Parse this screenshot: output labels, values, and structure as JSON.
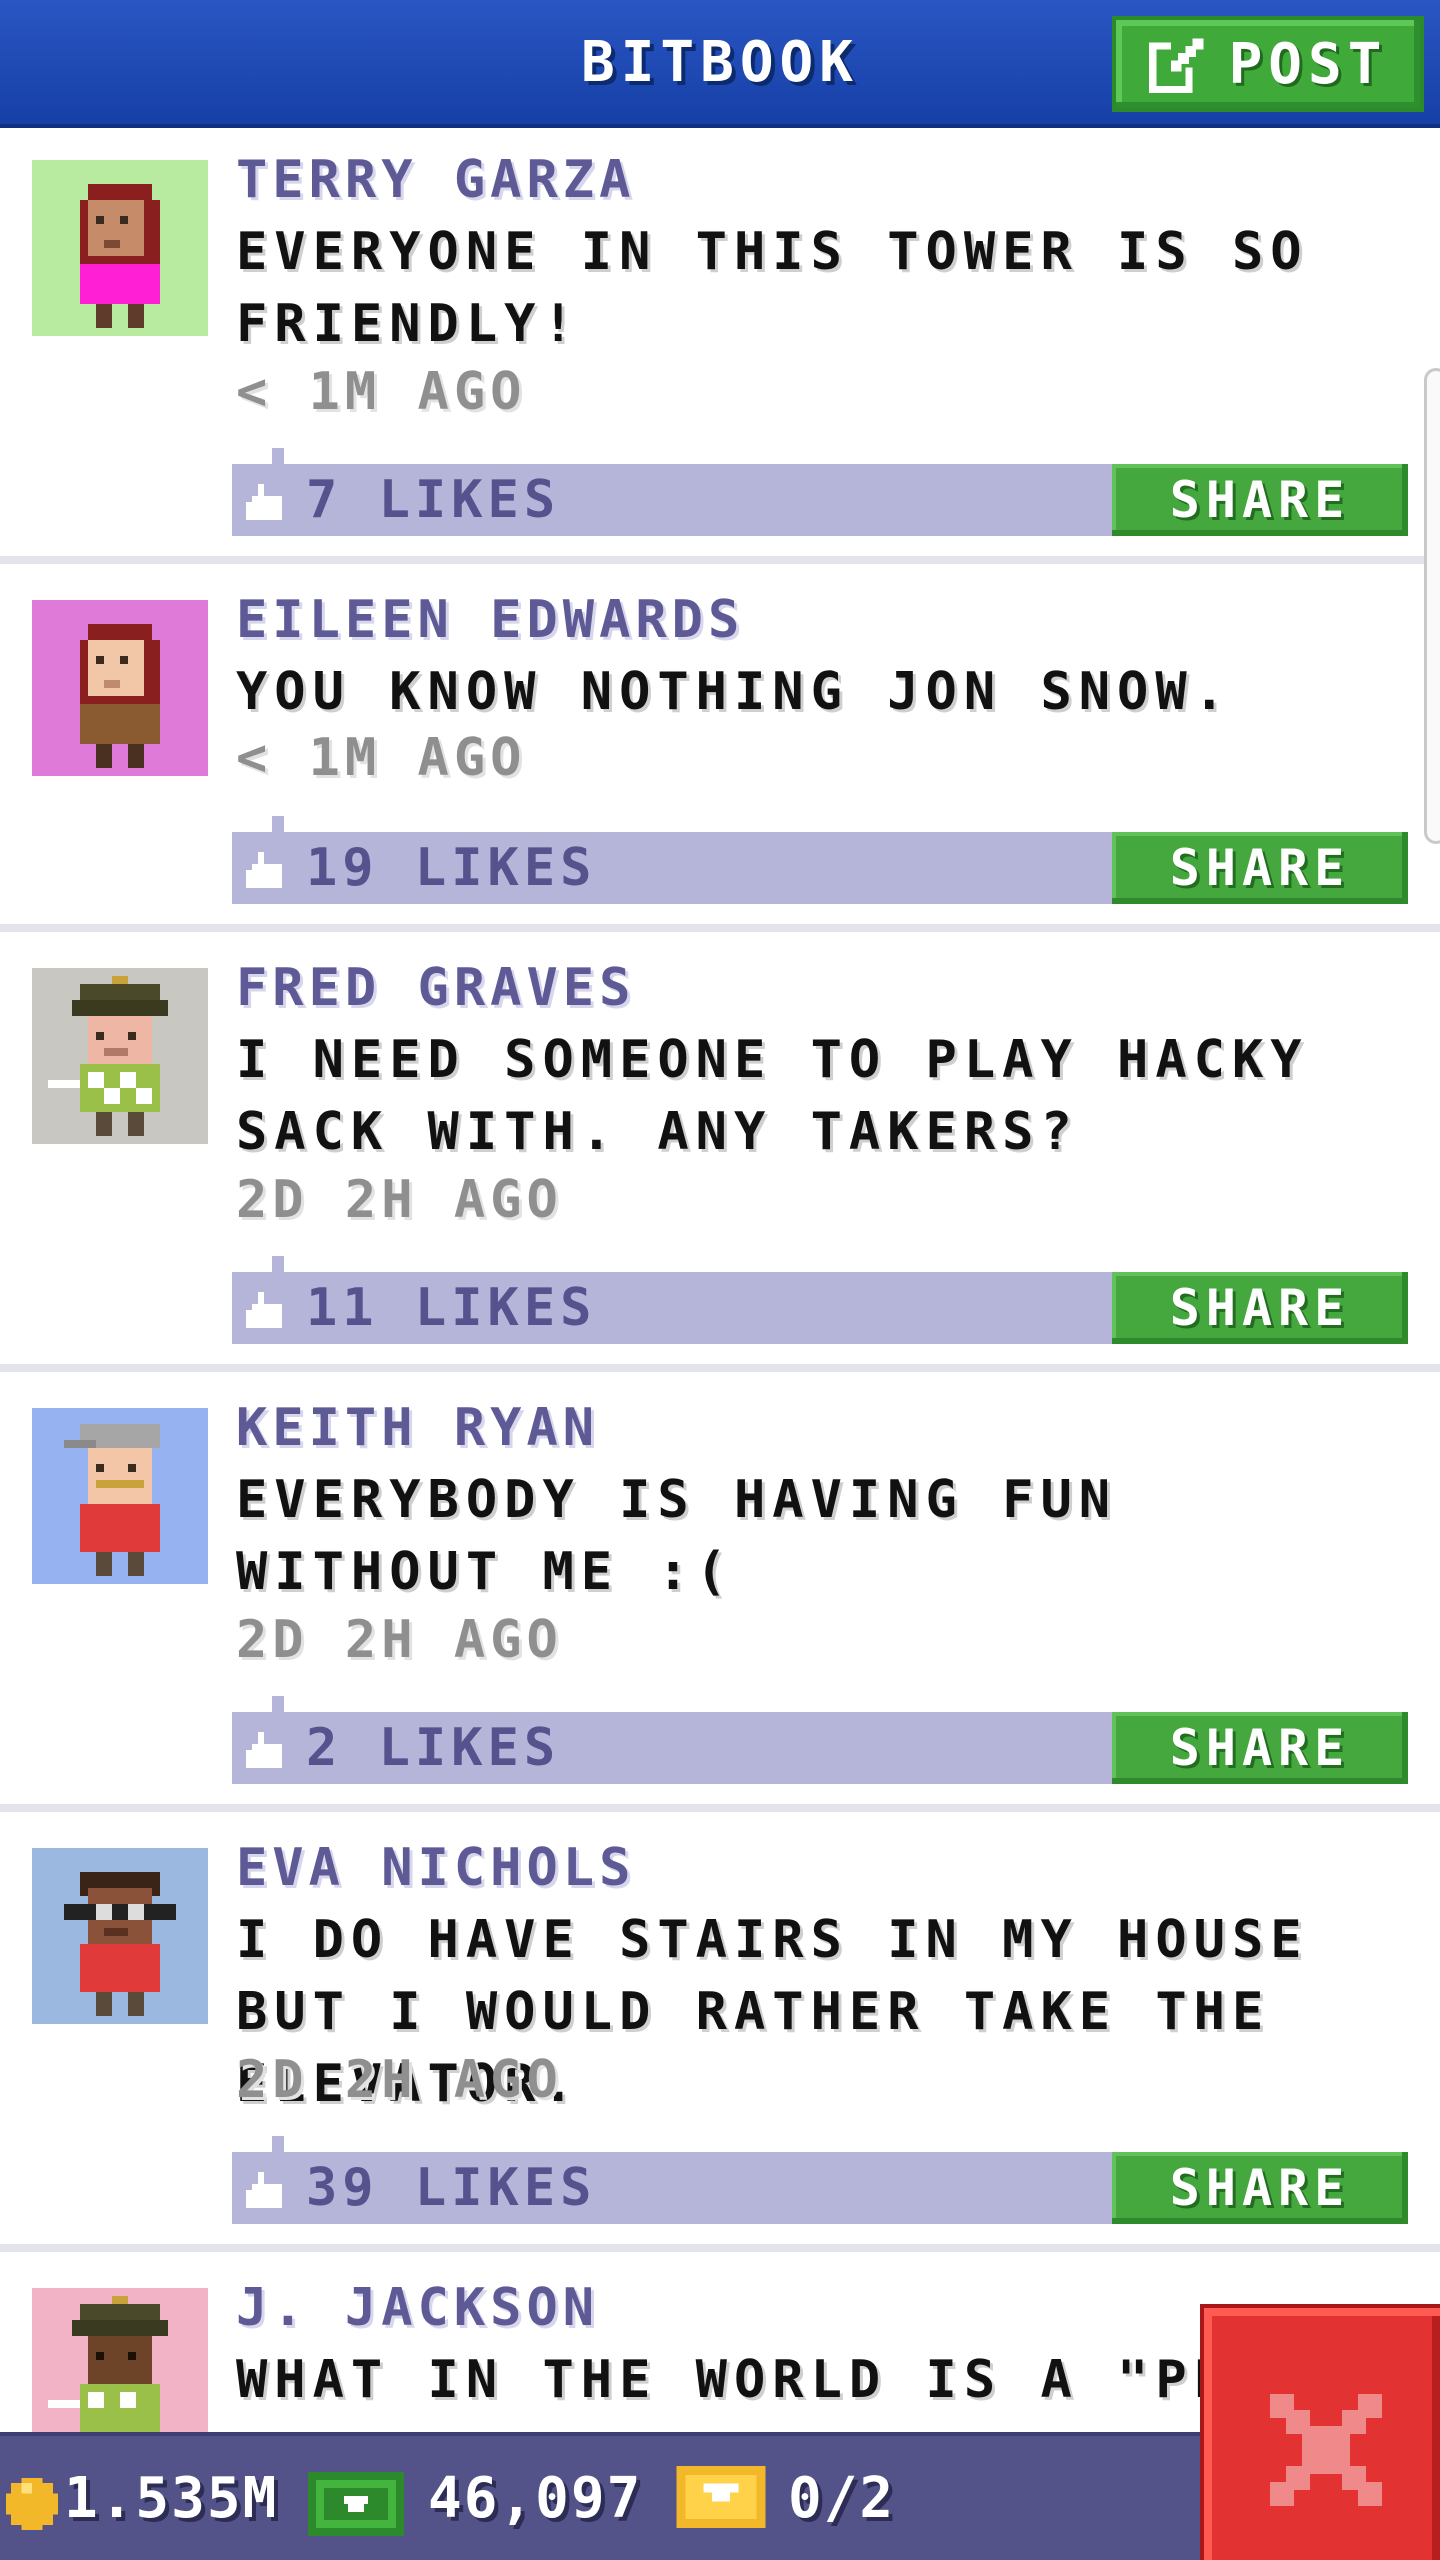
{
  "header": {
    "title": "BITBOOK",
    "post_label": "POST"
  },
  "posts": [
    {
      "name": "TERRY GARZA",
      "message": "EVERYONE IN THIS TOWER IS SO FRIENDLY!",
      "time": "< 1M AGO",
      "likes": "7 LIKES",
      "share": "SHARE"
    },
    {
      "name": "EILEEN EDWARDS",
      "message": "YOU KNOW NOTHING JON SNOW.",
      "time": "< 1M AGO",
      "likes": "19 LIKES",
      "share": "SHARE"
    },
    {
      "name": "FRED GRAVES",
      "message": "I NEED SOMEONE TO PLAY HACKY SACK WITH. ANY TAKERS?",
      "time": "2D 2H AGO",
      "likes": "11 LIKES",
      "share": "SHARE"
    },
    {
      "name": "KEITH RYAN",
      "message": "EVERYBODY IS HAVING FUN WITHOUT ME :(",
      "time": "2D 2H AGO",
      "likes": "2 LIKES",
      "share": "SHARE"
    },
    {
      "name": "EVA NICHOLS",
      "message": "I DO HAVE STAIRS IN MY HOUSE BUT I WOULD RATHER TAKE THE ELEVATOR.",
      "time": "2D 2H AGO",
      "likes": "39 LIKES",
      "share": "SHARE"
    },
    {
      "name": "J. JACKSON",
      "message": "WHAT IN THE WORLD IS A \"PEWD"
    }
  ],
  "status": {
    "coins": "1.535M",
    "bux": "46,097",
    "tickets": "0/2"
  },
  "icons": {
    "post": "edit-icon",
    "like": "thumbs-up-icon",
    "coin": "coin-icon",
    "bux": "cash-icon",
    "ticket": "ticket-icon",
    "close": "close-icon"
  },
  "colors": {
    "header": "#1640a6",
    "accent_green": "#45a83e",
    "name_purple": "#5e5a96",
    "like_bar": "#b4b5d8",
    "status_bar": "#53538a",
    "close_red": "#e23232"
  }
}
